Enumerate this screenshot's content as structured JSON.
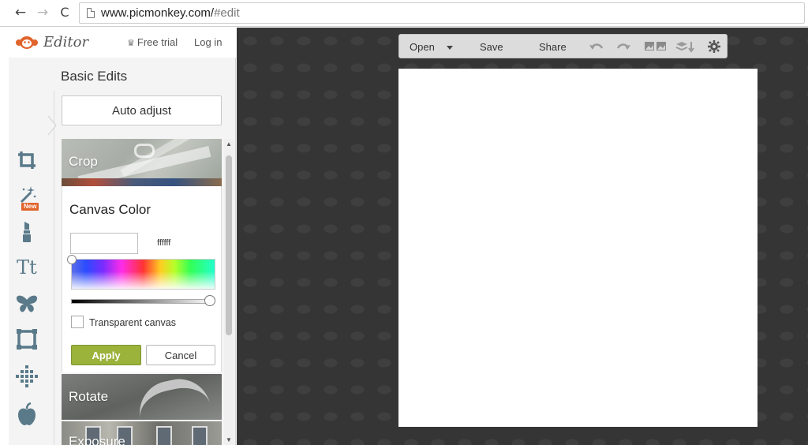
{
  "browser": {
    "url_domain": "www.picmonkey.com/",
    "url_path": "#edit",
    "back_glyph": "←",
    "forward_glyph": "→",
    "reload_glyph": "C"
  },
  "header": {
    "logo_text": "Editor",
    "free_trial": "Free trial",
    "login": "Log in"
  },
  "tools": [
    {
      "icon": "crop-icon"
    },
    {
      "icon": "magic-wand-icon",
      "badge": "New"
    },
    {
      "icon": "lipstick-icon"
    },
    {
      "icon": "text-icon",
      "label": "Tt"
    },
    {
      "icon": "butterfly-icon"
    },
    {
      "icon": "frame-icon"
    },
    {
      "icon": "texture-icon"
    },
    {
      "icon": "apple-icon"
    }
  ],
  "panel": {
    "title": "Basic Edits",
    "auto_adjust": "Auto adjust",
    "crop_label": "Crop",
    "canvas_color": {
      "title": "Canvas Color",
      "hex_value": "ffffff",
      "transparent_label": "Transparent canvas",
      "apply": "Apply",
      "cancel": "Cancel"
    },
    "rotate_label": "Rotate",
    "exposure_label": "Exposure"
  },
  "toolbar": {
    "open": "Open",
    "save": "Save",
    "share": "Share"
  },
  "colors": {
    "accent_green": "#9bb23b",
    "tool_blue": "#5a7a8a",
    "logo_orange": "#e0642c",
    "workspace_bg": "#353535"
  }
}
